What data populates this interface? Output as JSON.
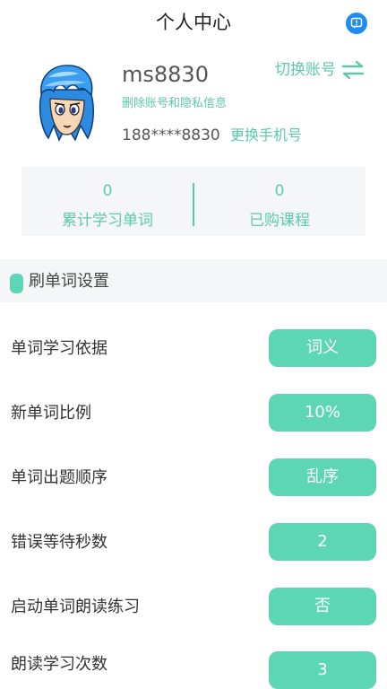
{
  "header": {
    "title": "个人中心",
    "message_icon": "chat-bubble-icon"
  },
  "profile": {
    "username": "ms8830",
    "delete_link": "删除账号和隐私信息",
    "phone": "188****8830",
    "change_phone": "更换手机号",
    "switch_account": "切换账号",
    "avatar": "cartoon-avatar"
  },
  "stats": [
    {
      "value": "0",
      "label": "累计学习单词"
    },
    {
      "value": "0",
      "label": "已购课程"
    }
  ],
  "section": {
    "title": "刷单词设置"
  },
  "settings": [
    {
      "label": "单词学习依据",
      "value": "词义"
    },
    {
      "label": "新单词比例",
      "value": "10%"
    },
    {
      "label": "单词出题顺序",
      "value": "乱序"
    },
    {
      "label": "错误等待秒数",
      "value": "2"
    },
    {
      "label": "启动单词朗读练习",
      "value": "否"
    },
    {
      "label": "朗读学习次数",
      "value": "3"
    }
  ],
  "colors": {
    "accent": "#5cd6b4",
    "accent_text": "#5cc9ad",
    "message_blue": "#1e8cf0"
  }
}
